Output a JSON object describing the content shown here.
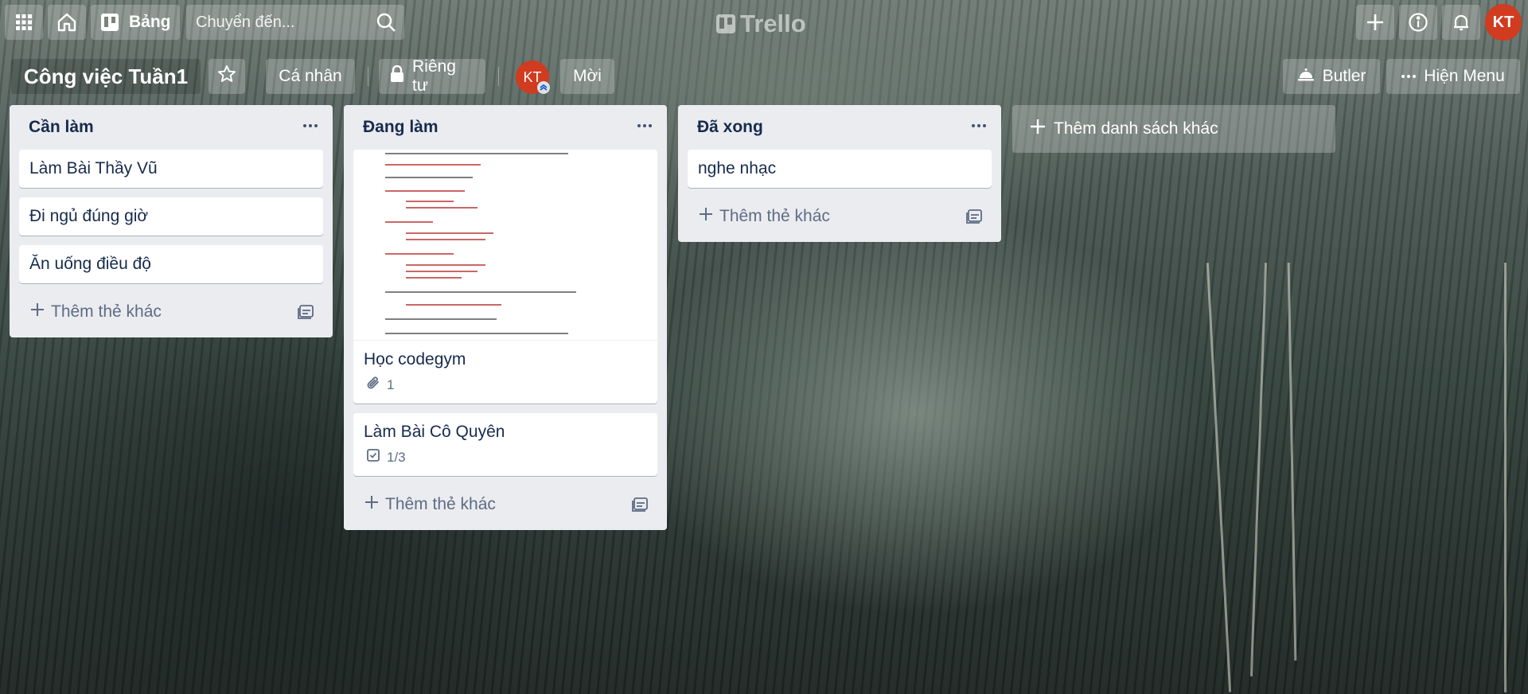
{
  "topbar": {
    "apps_icon": "grid-icon",
    "home_icon": "home-icon",
    "boards_label": "Bảng",
    "search_placeholder": "Chuyển đến...",
    "logo_text": "Trello",
    "user_initials": "KT"
  },
  "board": {
    "title": "Công việc Tuần1",
    "visibility_team": "Cá nhân",
    "visibility_privacy": "Riêng tư",
    "member_initials": "KT",
    "invite_label": "Mời",
    "butler_label": "Butler",
    "menu_label": "Hiện Menu"
  },
  "lists": [
    {
      "title": "Cần làm",
      "cards": [
        {
          "title": "Làm Bài Thầy Vũ"
        },
        {
          "title": "Đi ngủ đúng giờ"
        },
        {
          "title": "Ăn uống điều độ"
        }
      ],
      "add_card_label": "Thêm thẻ khác"
    },
    {
      "title": "Đang làm",
      "cards": [
        {
          "title": "Học codegym",
          "badge_icon": "paperclip-icon",
          "badge_text": "1"
        },
        {
          "title": "Làm Bài Cô Quyên",
          "badge_icon": "checklist-icon",
          "badge_text": "1/3"
        }
      ],
      "add_card_label": "Thêm thẻ khác"
    },
    {
      "title": "Đã xong",
      "cards": [
        {
          "title": "nghe nhạc"
        }
      ],
      "add_card_label": "Thêm thẻ khác"
    }
  ],
  "add_list_label": "Thêm danh sách khác",
  "colors": {
    "list_bg": "#ebecf0",
    "avatar": "#d13b1f",
    "text_dark": "#172b4d",
    "text_muted": "#5e6c84"
  }
}
